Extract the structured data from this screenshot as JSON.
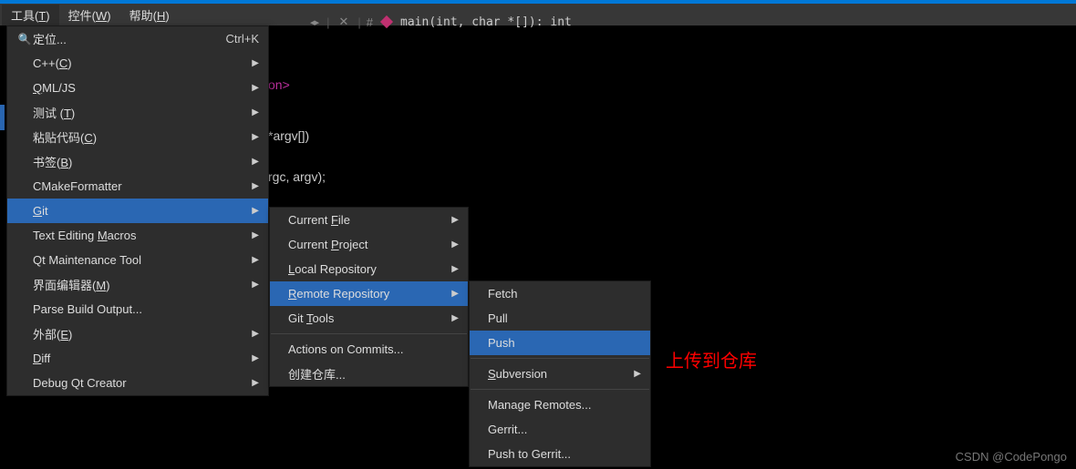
{
  "menubar": {
    "tools": "工具(",
    "tools_ul": "T",
    "tools_end": ")",
    "widgets": "控件(",
    "widgets_ul": "W",
    "widgets_end": ")",
    "help": "帮助(",
    "help_ul": "H",
    "help_end": ")"
  },
  "breadcrumb": {
    "arrows": "◂ ▸",
    "close": "✕",
    "hash": "#",
    "signature": "main(int, char *[]): int"
  },
  "editor": {
    "line1_tail": "on>",
    "line2": "*argv[])",
    "line3": "rgc, argv);"
  },
  "menu1": {
    "locate": "定位...",
    "locate_shortcut": "Ctrl+K",
    "cpp_pre": "C++(",
    "cpp_ul": "C",
    "cpp_post": ")",
    "qml_pre": "",
    "qml_ul": "Q",
    "qml_post": "ML/JS",
    "test_pre": "测试  (",
    "test_ul": "T",
    "test_post": ")",
    "paste_pre": "粘贴代码(",
    "paste_ul": "C",
    "paste_post": ")",
    "bookmark_pre": "书签(",
    "bookmark_ul": "B",
    "bookmark_post": ")",
    "cmake": "CMakeFormatter",
    "git_ul": "G",
    "git_post": "it",
    "macros_pre": "Text Editing ",
    "macros_ul": "M",
    "macros_post": "acros",
    "qtmaint": "Qt Maintenance Tool",
    "formedit_pre": "界面编辑器(",
    "formedit_ul": "M",
    "formedit_post": ")",
    "parse": "Parse Build Output...",
    "ext_pre": "外部(",
    "ext_ul": "E",
    "ext_post": ")",
    "diff_ul": "D",
    "diff_post": "iff",
    "debugqt": "Debug Qt Creator"
  },
  "menu2": {
    "curfile_pre": "Current ",
    "curfile_ul": "F",
    "curfile_post": "ile",
    "curproj_pre": "Current ",
    "curproj_ul": "P",
    "curproj_post": "roject",
    "local_ul": "L",
    "local_post": "ocal Repository",
    "remote_ul": "R",
    "remote_post": "emote Repository",
    "tools_pre": "Git ",
    "tools_ul": "T",
    "tools_post": "ools",
    "actions": "Actions on Commits...",
    "create": "创建仓库..."
  },
  "menu3": {
    "fetch": "Fetch",
    "pull": "Pull",
    "push": "Push",
    "subversion_ul": "S",
    "subversion_post": "ubversion",
    "manage": "Manage Remotes...",
    "gerrit": "Gerrit...",
    "pushgerrit": "Push to Gerrit..."
  },
  "annotation": "上传到仓库",
  "watermark": "CSDN @CodePongo"
}
